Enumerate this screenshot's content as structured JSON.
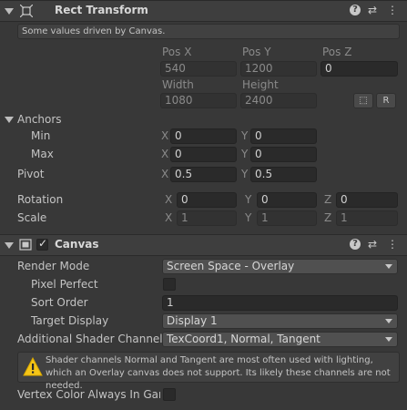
{
  "rect_transform": {
    "title": "Rect Transform",
    "driven_notice": "Some values driven by Canvas.",
    "pos_x_label": "Pos X",
    "pos_y_label": "Pos Y",
    "pos_z_label": "Pos Z",
    "pos_x": "540",
    "pos_y": "1200",
    "pos_z": "0",
    "width_label": "Width",
    "height_label": "Height",
    "width": "1080",
    "height": "2400",
    "raw_button": "R",
    "anchors_label": "Anchors",
    "min_label": "Min",
    "max_label": "Max",
    "min_x": "0",
    "min_y": "0",
    "max_x": "0",
    "max_y": "0",
    "pivot_label": "Pivot",
    "pivot_x": "0.5",
    "pivot_y": "0.5",
    "rotation_label": "Rotation",
    "rot_x": "0",
    "rot_y": "0",
    "rot_z": "0",
    "scale_label": "Scale",
    "scale_x": "1",
    "scale_y": "1",
    "scale_z": "1",
    "axis_x": "X",
    "axis_y": "Y",
    "axis_z": "Z"
  },
  "canvas": {
    "title": "Canvas",
    "enabled": true,
    "render_mode_label": "Render Mode",
    "render_mode_value": "Screen Space - Overlay",
    "pixel_perfect_label": "Pixel Perfect",
    "pixel_perfect": false,
    "sort_order_label": "Sort Order",
    "sort_order": "1",
    "target_display_label": "Target Display",
    "target_display_value": "Display 1",
    "shader_channels_label": "Additional Shader Channels",
    "shader_channels_value": "TexCoord1, Normal, Tangent",
    "warning_text": "Shader channels Normal and Tangent are most often used with lighting, which an Overlay canvas does not support. Its likely these channels are not needed.",
    "vertex_color_label": "Vertex Color Always In Gamma",
    "vertex_color": false
  },
  "icons": {
    "help": "help-icon",
    "presets": "presets-icon",
    "more": "more-options-icon"
  }
}
